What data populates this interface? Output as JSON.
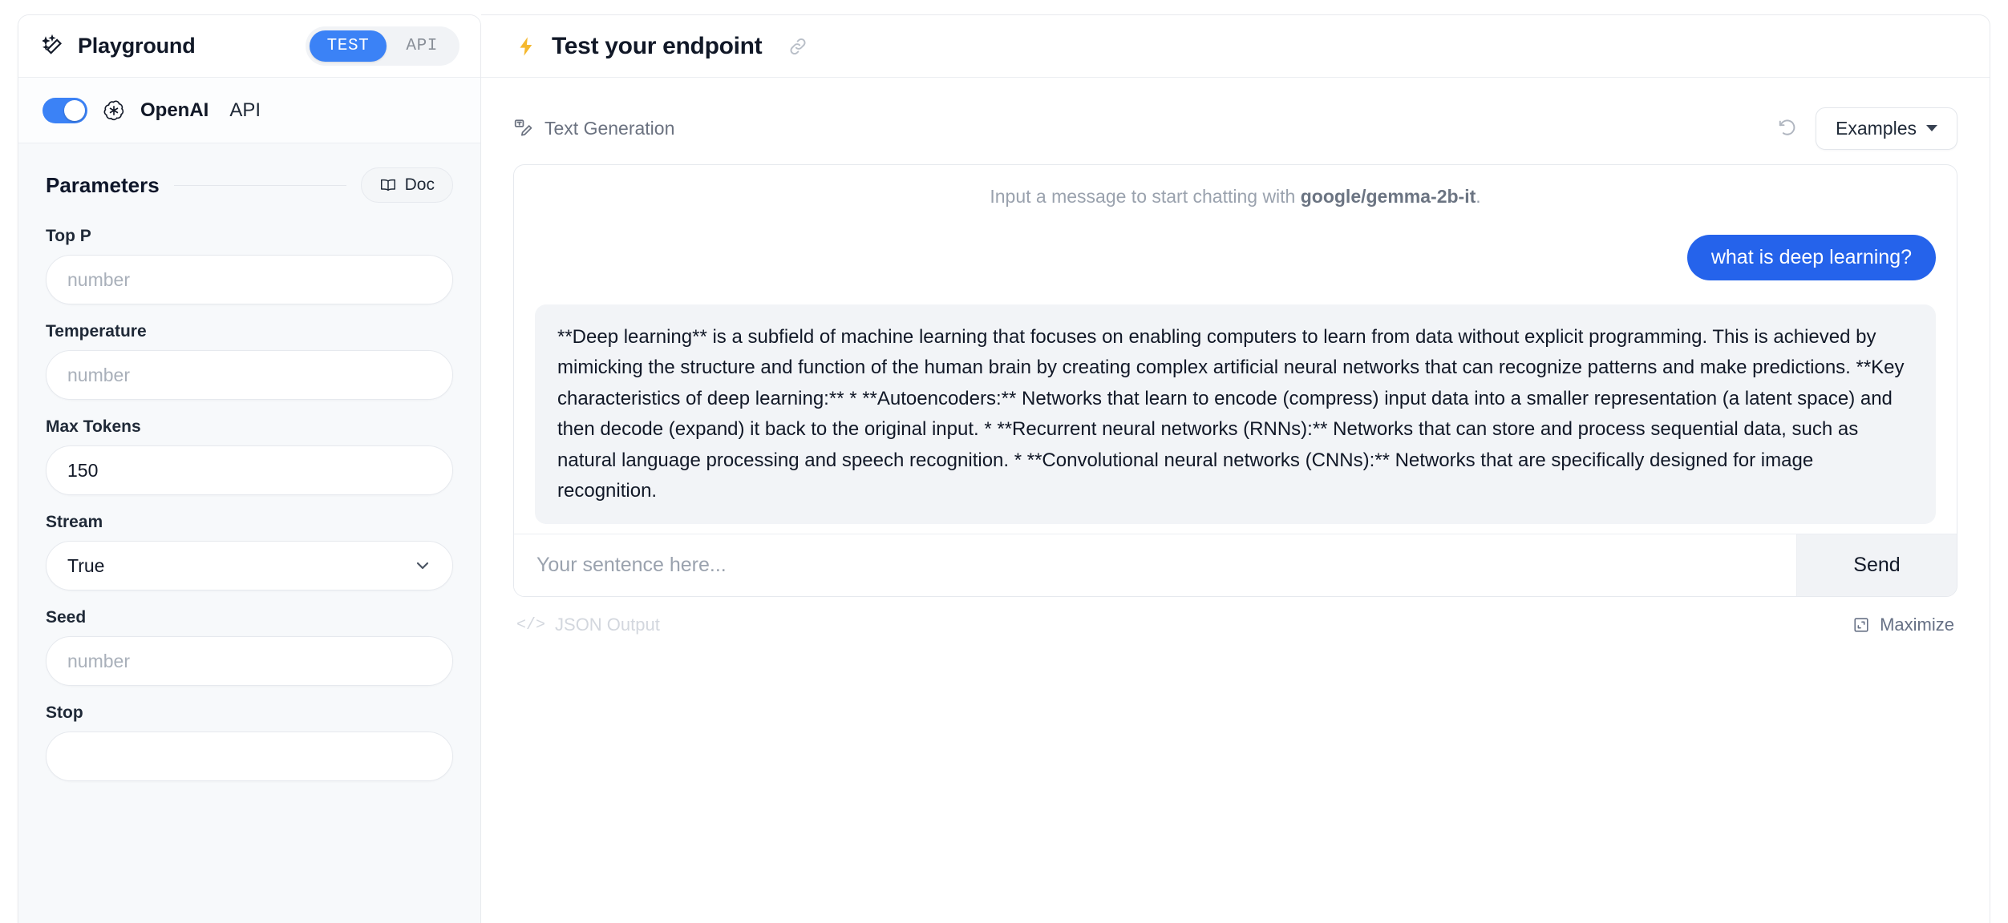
{
  "sidebar": {
    "title": "Playground",
    "wand_icon": "magic-wand-icon",
    "segmented": {
      "test_label": "TEST",
      "api_label": "API",
      "active": "TEST"
    },
    "provider": {
      "toggle_state": "on",
      "icon": "openai-logo-icon",
      "name": "OpenAI",
      "suffix": "API"
    },
    "parameters_title": "Parameters",
    "doc_button": {
      "label": "Doc",
      "icon": "book-icon"
    },
    "fields": [
      {
        "label": "Top P",
        "value": "",
        "placeholder": "number",
        "type": "input"
      },
      {
        "label": "Temperature",
        "value": "",
        "placeholder": "number",
        "type": "input"
      },
      {
        "label": "Max Tokens",
        "value": "150",
        "placeholder": "",
        "type": "input"
      },
      {
        "label": "Stream",
        "value": "True",
        "placeholder": "",
        "type": "select"
      },
      {
        "label": "Seed",
        "value": "",
        "placeholder": "number",
        "type": "input"
      },
      {
        "label": "Stop",
        "value": "",
        "placeholder": "",
        "type": "input"
      }
    ]
  },
  "main": {
    "header": {
      "bolt_icon": "lightning-bolt-icon",
      "title": "Test your endpoint",
      "link_icon": "link-icon"
    },
    "toolbar": {
      "task_icon": "text-generation-icon",
      "task_label": "Text Generation",
      "reset_icon": "reset-icon",
      "examples_label": "Examples"
    },
    "chat": {
      "hint_prefix": "Input a message to start chatting with ",
      "hint_model": "google/gemma-2b-it",
      "hint_suffix": ".",
      "user_message": "what is deep learning?",
      "bot_message": "**Deep learning** is a subfield of machine learning that focuses on enabling computers to learn from data without explicit programming. This is achieved by mimicking the structure and function of the human brain by creating complex artificial neural networks that can recognize patterns and make predictions. **Key characteristics of deep learning:** * **Autoencoders:** Networks that learn to encode (compress) input data into a smaller representation (a latent space) and then decode (expand) it back to the original input. * **Recurrent neural networks (RNNs):** Networks that can store and process sequential data, such as natural language processing and speech recognition. * **Convolutional neural networks (CNNs):** Networks that are specifically designed for image recognition."
    },
    "composer": {
      "placeholder": "Your sentence here...",
      "send_label": "Send"
    },
    "footer": {
      "json_glyph": "</>",
      "json_label": "JSON Output",
      "maximize_label": "Maximize",
      "maximize_icon": "maximize-icon"
    }
  },
  "colors": {
    "accent_blue": "#3b82f6",
    "user_bubble": "#2563eb",
    "bot_bubble": "#f2f4f7",
    "bolt_yellow": "#f5b82e",
    "sidebar_bg": "#f7f9fb"
  }
}
